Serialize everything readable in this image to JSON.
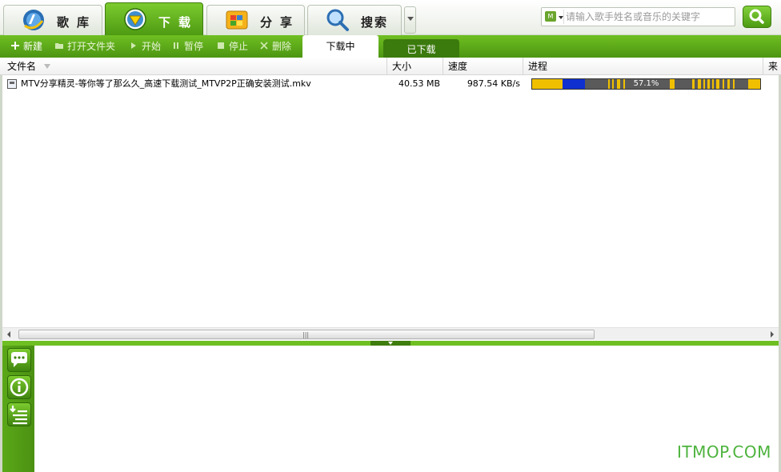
{
  "nav": {
    "tabs": [
      {
        "label": "歌库",
        "icon": "music-library-icon"
      },
      {
        "label": "下载",
        "icon": "download-icon"
      },
      {
        "label": "分享",
        "icon": "share-icon"
      },
      {
        "label": "搜索",
        "icon": "search-icon"
      }
    ],
    "active_tab": "下载"
  },
  "search": {
    "type_icon": "mtv-icon",
    "placeholder": "请输入歌手姓名或音乐的关键字"
  },
  "toolbar": {
    "new_label": "新建",
    "open_folder_label": "打开文件夹",
    "start_label": "开始",
    "pause_label": "暂停",
    "stop_label": "停止",
    "delete_label": "删除"
  },
  "subtabs": {
    "downloading": "下载中",
    "downloaded": "已下载"
  },
  "columns": {
    "name": "文件名",
    "size": "大小",
    "speed": "速度",
    "progress": "进程",
    "source": "来"
  },
  "downloads": [
    {
      "name": "MTV分享精灵-等你等了那么久_高速下载测试_MTVP2P正确安装测试.mkv",
      "size": "40.53 MB",
      "speed": "987.54 KB/s",
      "progress_text": "57.1%",
      "progress": 0.571
    }
  ],
  "watermark": "ITMOP.COM",
  "colors": {
    "accent_green": "#5aa818",
    "progress_yellow": "#f0c000",
    "progress_blue": "#1030d0"
  }
}
